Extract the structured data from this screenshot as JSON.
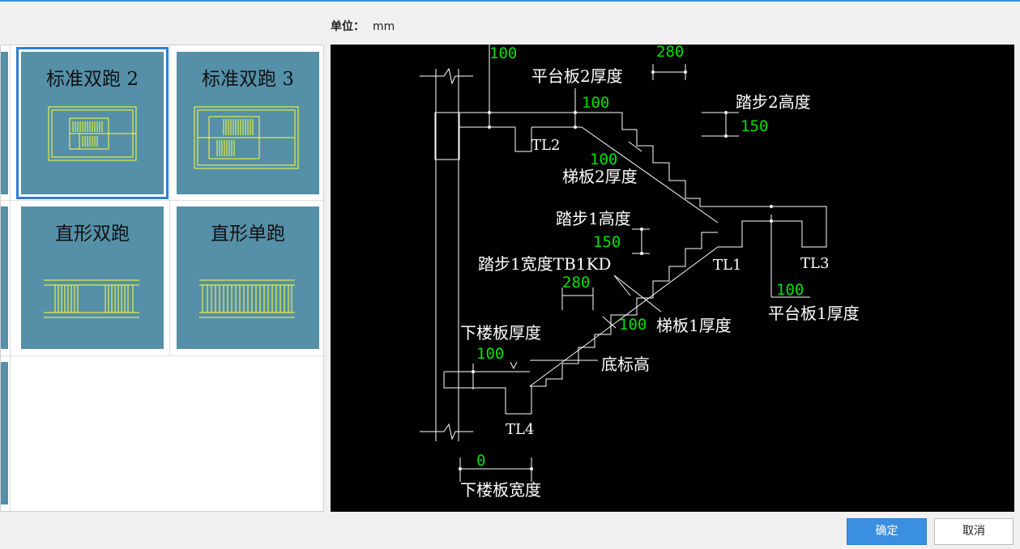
{
  "unit": {
    "label": "单位：",
    "value": "mm"
  },
  "tiles": [
    {
      "label": "标准双跑 2"
    },
    {
      "label": "标准双跑 3"
    },
    {
      "label": "直形双跑"
    },
    {
      "label": "直形单跑"
    }
  ],
  "diagram": {
    "labels": {
      "pt2_thick": "平台板2厚度",
      "tb2_thick": "梯板2厚度",
      "step2_h": "踏步2高度",
      "step1_h": "踏步1高度",
      "step1_w": "踏步1宽度TB1KD",
      "lower_thick": "下楼板厚度",
      "bottom_elev": "底标高",
      "tb1_thick": "梯板1厚度",
      "pt1_thick": "平台板1厚度",
      "lower_w": "下楼板宽度",
      "tl1": "TL1",
      "tl2": "TL2",
      "tl3": "TL3",
      "tl4": "TL4"
    },
    "values": {
      "top_100": "100",
      "top_280": "280",
      "pt2_100": "100",
      "step2_150": "150",
      "tb2_100": "100",
      "step1_150": "150",
      "step1_280": "280",
      "tb1_100": "100",
      "lower_100": "100",
      "pt1_100": "100",
      "lower_w_0": "0"
    }
  },
  "buttons": {
    "ok": "确定",
    "cancel": "取消"
  },
  "colors": {
    "accent": "#3b8fe0",
    "tile": "#5590a8",
    "cad_green": "#00e000",
    "cad_yellow": "#ffff33"
  }
}
